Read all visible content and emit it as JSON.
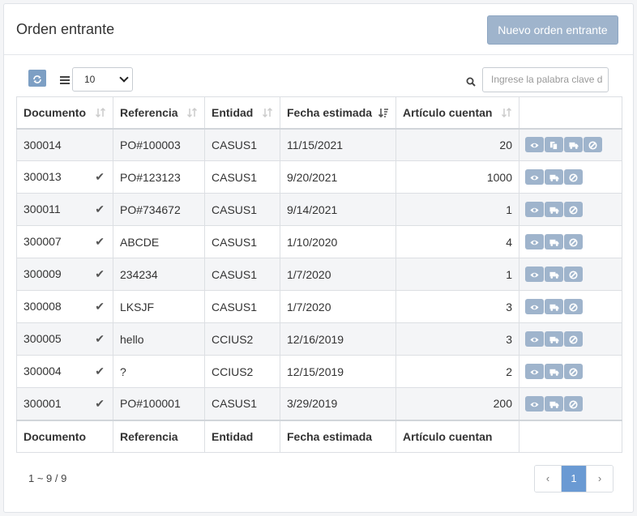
{
  "header": {
    "title": "Orden entrante",
    "new_button": "Nuevo orden entrante"
  },
  "toolbar": {
    "page_size": "10",
    "search_placeholder": "Ingrese la palabra clave d"
  },
  "table": {
    "columns": [
      "Documento",
      "Referencia",
      "Entidad",
      "Fecha estimada",
      "Artículo cuentan"
    ],
    "rows": [
      {
        "documento": "300014",
        "checked": false,
        "referencia": "PO#100003",
        "entidad": "CASUS1",
        "fecha": "11/15/2021",
        "cuenta": "20",
        "actions": [
          "eye-icon",
          "copy-icon",
          "truck-icon",
          "ban-icon"
        ]
      },
      {
        "documento": "300013",
        "checked": true,
        "referencia": "PO#123123",
        "entidad": "CASUS1",
        "fecha": "9/20/2021",
        "cuenta": "1000",
        "actions": [
          "eye-icon",
          "truck-icon",
          "ban-icon"
        ]
      },
      {
        "documento": "300011",
        "checked": true,
        "referencia": "PO#734672",
        "entidad": "CASUS1",
        "fecha": "9/14/2021",
        "cuenta": "1",
        "actions": [
          "eye-icon",
          "truck-icon",
          "ban-icon"
        ]
      },
      {
        "documento": "300007",
        "checked": true,
        "referencia": "ABCDE",
        "entidad": "CASUS1",
        "fecha": "1/10/2020",
        "cuenta": "4",
        "actions": [
          "eye-icon",
          "truck-icon",
          "ban-icon"
        ]
      },
      {
        "documento": "300009",
        "checked": true,
        "referencia": "234234",
        "entidad": "CASUS1",
        "fecha": "1/7/2020",
        "cuenta": "1",
        "actions": [
          "eye-icon",
          "truck-icon",
          "ban-icon"
        ]
      },
      {
        "documento": "300008",
        "checked": true,
        "referencia": "LKSJF",
        "entidad": "CASUS1",
        "fecha": "1/7/2020",
        "cuenta": "3",
        "actions": [
          "eye-icon",
          "truck-icon",
          "ban-icon"
        ]
      },
      {
        "documento": "300005",
        "checked": true,
        "referencia": "hello",
        "entidad": "CCIUS2",
        "fecha": "12/16/2019",
        "cuenta": "3",
        "actions": [
          "eye-icon",
          "truck-icon",
          "ban-icon"
        ]
      },
      {
        "documento": "300004",
        "checked": true,
        "referencia": "?",
        "entidad": "CCIUS2",
        "fecha": "12/15/2019",
        "cuenta": "2",
        "actions": [
          "eye-icon",
          "truck-icon",
          "ban-icon"
        ]
      },
      {
        "documento": "300001",
        "checked": true,
        "referencia": "PO#100001",
        "entidad": "CASUS1",
        "fecha": "3/29/2019",
        "cuenta": "200",
        "actions": [
          "eye-icon",
          "truck-icon",
          "ban-icon"
        ]
      }
    ]
  },
  "footer": {
    "info": "1 ~ 9 / 9",
    "prev": "‹",
    "page": "1",
    "next": "›"
  },
  "colors": {
    "button": "#9fb4cc",
    "accent": "#6a9ad3",
    "refresh": "#7d9fc4"
  }
}
